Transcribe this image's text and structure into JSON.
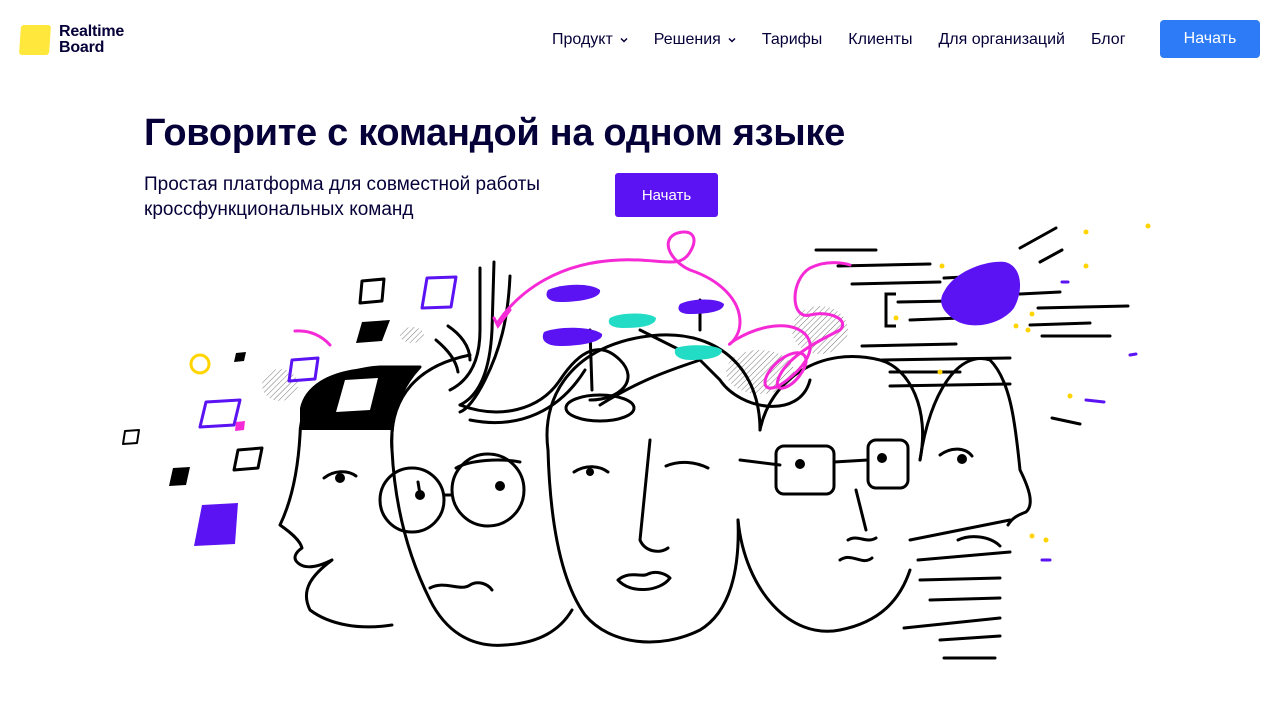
{
  "brand": {
    "name": "Realtime\nBoard",
    "logo_color": "#ffe83b"
  },
  "nav": {
    "items": [
      {
        "label": "Продукт",
        "has_dropdown": true
      },
      {
        "label": "Решения",
        "has_dropdown": true
      },
      {
        "label": "Тарифы",
        "has_dropdown": false
      },
      {
        "label": "Клиенты",
        "has_dropdown": false
      },
      {
        "label": "Для организаций",
        "has_dropdown": false
      },
      {
        "label": "Блог",
        "has_dropdown": false
      }
    ],
    "cta_label": "Начать",
    "cta_color": "#2d7bf6"
  },
  "hero": {
    "title": "Говорите с командой на одном языке",
    "subtitle_line1": "Простая платформа для совместной работы",
    "subtitle_line2": "кроссфункциональных команд",
    "cta_label": "Начать",
    "cta_color": "#5b13f3"
  },
  "illustration": {
    "name": "team-faces-illustration",
    "accent_colors": {
      "purple": "#5b13f3",
      "magenta": "#f52ad6",
      "teal": "#23dcc5",
      "yellow": "#ffd400",
      "ink": "#000000"
    }
  }
}
